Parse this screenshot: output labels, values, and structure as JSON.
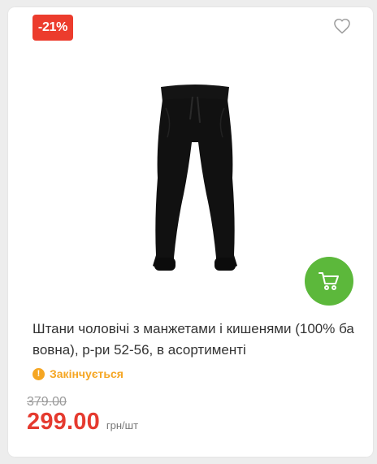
{
  "badge": {
    "discount": "-21%"
  },
  "product": {
    "title": "Штани чоловічі з манжетами і кишенями (100% бавовна), р-ри 52-56, в асортименті",
    "stock_status": "Закінчується",
    "old_price": "379.00",
    "price": "299.00",
    "price_unit": "грн/шт"
  },
  "icons": {
    "favorite": "heart-icon",
    "cart": "shopping-cart-icon",
    "stock": "exclamation-icon"
  },
  "colors": {
    "badge_bg": "#ec3c2d",
    "cart_button": "#5cb83b",
    "stock_status": "#f5a623",
    "price": "#e53a2f",
    "old_price": "#9a9a9a"
  }
}
